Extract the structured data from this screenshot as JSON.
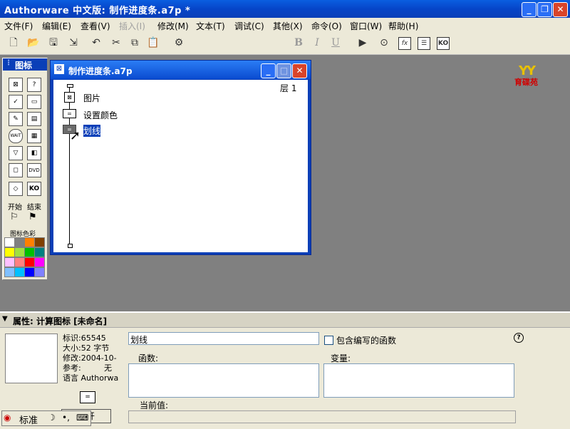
{
  "app": {
    "title": "Authorware 中文版: 制作进度条.a7p *",
    "minimize_icon": "minimize-icon",
    "maximize_icon": "maximize-icon",
    "close_icon": "close-icon"
  },
  "menu": {
    "items": [
      {
        "label": "文件(F)",
        "enabled": true
      },
      {
        "label": "编辑(E)",
        "enabled": true
      },
      {
        "label": "查看(V)",
        "enabled": true
      },
      {
        "label": "插入(I)",
        "enabled": false
      },
      {
        "label": "修改(M)",
        "enabled": true
      },
      {
        "label": "文本(T)",
        "enabled": true
      },
      {
        "label": "调试(C)",
        "enabled": true
      },
      {
        "label": "其他(X)",
        "enabled": true
      },
      {
        "label": "命令(O)",
        "enabled": true
      },
      {
        "label": "窗口(W)",
        "enabled": true
      },
      {
        "label": "帮助(H)",
        "enabled": true
      }
    ]
  },
  "toolbar": {
    "bold_label": "B",
    "italic_label": "I",
    "underline_label": "U",
    "fx_label": "fx",
    "ko_label": "KO",
    "font_combo_value": "",
    "logo_text": "育碟苑"
  },
  "palette": {
    "title": "图标",
    "start_label": "开始",
    "end_label": "结束",
    "colors_label": "图标色彩",
    "wait_label": "WAIT",
    "dvd_label": "DVD",
    "ko_label": "KO",
    "colors": [
      "#ffffff",
      "#808080",
      "#ff8000",
      "#804000",
      "#ffff00",
      "#a0e040",
      "#00c000",
      "#008080",
      "#ffc0ff",
      "#ff8080",
      "#ff0000",
      "#ff00ff",
      "#80c0ff",
      "#00c0ff",
      "#0000ff",
      "#8080ff"
    ]
  },
  "flowwin": {
    "title": "制作进度条.a7p",
    "level": "层 1",
    "nodes": [
      {
        "label": "图片",
        "selected": false
      },
      {
        "label": "设置颜色",
        "selected": false
      },
      {
        "label": "划线",
        "selected": true
      }
    ]
  },
  "props": {
    "title": "属性: 计算图标 [未命名]",
    "id_text": "标识:65545",
    "size_text": "大小:52 字节",
    "modified_text": "修改:2004-10-",
    "ref_text": "参考:",
    "ref_value": "无",
    "lang_text": "语言 Authorwa",
    "name_value": "划线",
    "include_label": "包含编写的函数",
    "functions_label": "函数:",
    "variables_label": "变量:",
    "current_value_label": "当前值:",
    "help_label": "?",
    "open_button_label": "打开"
  },
  "statusbar": {
    "ime_label": "标准"
  }
}
